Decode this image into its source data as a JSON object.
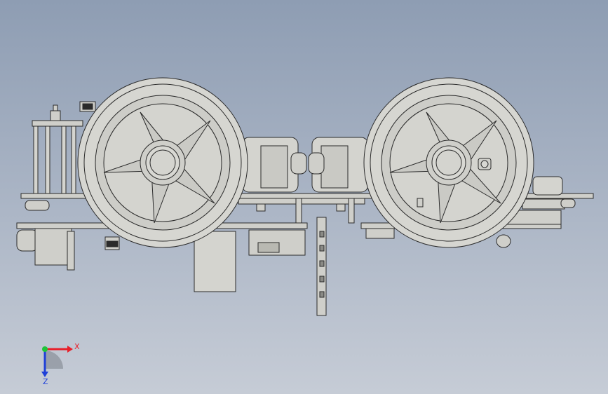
{
  "triad": {
    "x_label": "X",
    "z_label": "Z",
    "x_color": "#e8202a",
    "y_color": "#1fc43a",
    "z_color": "#1e3fd8"
  },
  "colors": {
    "part_fill": "#d9d9d4",
    "part_fill_dark": "#b9b9b2",
    "edge": "#2b2b2b",
    "bg_top": "#8e9db3",
    "bg_bottom": "#c6ccd6"
  },
  "icons": {
    "triad": "coordinate-triad-icon"
  }
}
